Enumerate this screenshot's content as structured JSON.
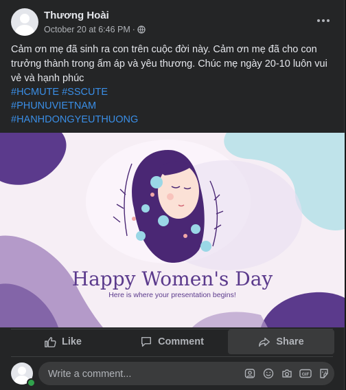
{
  "post": {
    "author": "Thương Hoài",
    "timestamp": "October 20 at 6:46 PM",
    "separator": "·",
    "privacy_icon": "globe-icon",
    "text": "Cảm ơn mẹ đã sinh ra con trên cuộc đời này. Cảm ơn mẹ đã cho con trưởng thành trong ấm áp và yêu thương. Chúc mẹ ngày 20-10 luôn vui vẻ và hạnh phúc",
    "hashtags": [
      "#HCMUTE #SSCUTE",
      "#PHUNUVIETNAM",
      "#HANHDONGYEUTHUONG"
    ],
    "image": {
      "title": "Happy Women's Day",
      "subtitle": "Here is where your presentation begins!"
    }
  },
  "actions": {
    "like": "Like",
    "comment": "Comment",
    "share": "Share"
  },
  "composer": {
    "placeholder": "Write a comment...",
    "icons": [
      "avatar-sticker-icon",
      "emoji-icon",
      "camera-icon",
      "gif-icon",
      "sticker-icon"
    ]
  },
  "colors": {
    "background": "#242526",
    "text": "#e4e6eb",
    "muted": "#b0b3b8",
    "link": "#3a8ee6",
    "online": "#31a24c",
    "illustration_purple": "#5b3a8c",
    "illustration_teal": "#bfe3ea"
  }
}
